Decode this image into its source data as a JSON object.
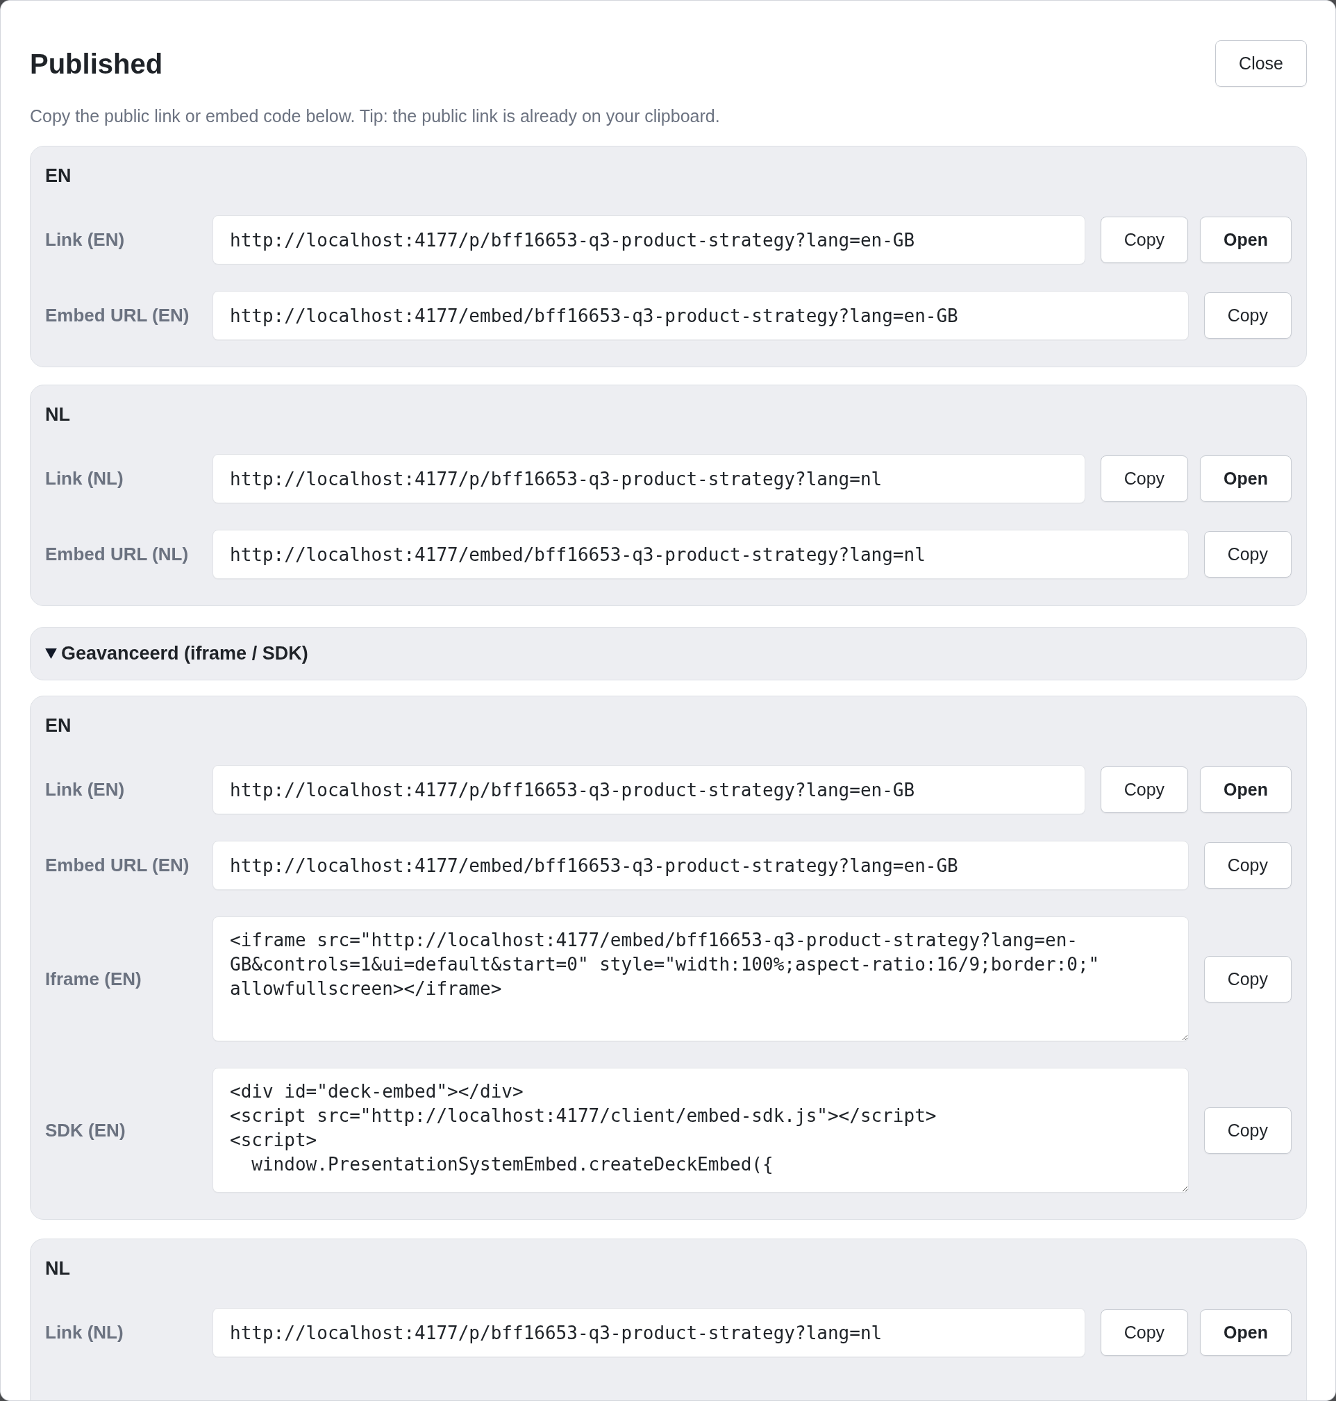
{
  "dialog": {
    "title": "Published",
    "close_button": "Close",
    "description": "Copy the public link or embed code below. Tip: the public link is already on your clipboard."
  },
  "sections": [
    {
      "heading": "EN",
      "rows": [
        {
          "kind": "input",
          "label": "Link (EN)",
          "value": "http://localhost:4177/p/bff16653-q3-product-strategy?lang=en-GB",
          "actions": [
            {
              "kind": "copy",
              "label": "Copy"
            },
            {
              "kind": "open",
              "label": "Open"
            }
          ]
        },
        {
          "kind": "input",
          "label": "Embed URL (EN)",
          "value": "http://localhost:4177/embed/bff16653-q3-product-strategy?lang=en-GB",
          "actions": [
            {
              "kind": "copy",
              "label": "Copy"
            }
          ]
        }
      ]
    },
    {
      "heading": "NL",
      "rows": [
        {
          "kind": "input",
          "label": "Link (NL)",
          "value": "http://localhost:4177/p/bff16653-q3-product-strategy?lang=nl",
          "actions": [
            {
              "kind": "copy",
              "label": "Copy"
            },
            {
              "kind": "open",
              "label": "Open"
            }
          ]
        },
        {
          "kind": "input",
          "label": "Embed URL (NL)",
          "value": "http://localhost:4177/embed/bff16653-q3-product-strategy?lang=nl",
          "actions": [
            {
              "kind": "copy",
              "label": "Copy"
            }
          ]
        }
      ]
    }
  ],
  "advanced": {
    "summary": "Geavanceerd (iframe / SDK)",
    "expanded": true,
    "sections": [
      {
        "heading": "EN",
        "rows": [
          {
            "kind": "input",
            "label": "Link (EN)",
            "value": "http://localhost:4177/p/bff16653-q3-product-strategy?lang=en-GB",
            "actions": [
              {
                "kind": "copy",
                "label": "Copy"
              },
              {
                "kind": "open",
                "label": "Open"
              }
            ]
          },
          {
            "kind": "input",
            "label": "Embed URL (EN)",
            "value": "http://localhost:4177/embed/bff16653-q3-product-strategy?lang=en-GB",
            "actions": [
              {
                "kind": "copy",
                "label": "Copy"
              }
            ]
          },
          {
            "kind": "textarea",
            "label": "Iframe (EN)",
            "value": "<iframe src=\"http://localhost:4177/embed/bff16653-q3-product-strategy?lang=en-GB&controls=1&ui=default&start=0\" style=\"width:100%;aspect-ratio:16/9;border:0;\" allowfullscreen></iframe>",
            "actions": [
              {
                "kind": "copy",
                "label": "Copy"
              }
            ]
          },
          {
            "kind": "textarea",
            "label": "SDK (EN)",
            "value": "<div id=\"deck-embed\"></div>\n<script src=\"http://localhost:4177/client/embed-sdk.js\"></script>\n<script>\n  window.PresentationSystemEmbed.createDeckEmbed({",
            "actions": [
              {
                "kind": "copy",
                "label": "Copy"
              }
            ]
          }
        ]
      },
      {
        "heading": "NL",
        "rows": [
          {
            "kind": "input",
            "label": "Link (NL)",
            "value": "http://localhost:4177/p/bff16653-q3-product-strategy?lang=nl",
            "actions": [
              {
                "kind": "copy",
                "label": "Copy"
              },
              {
                "kind": "open",
                "label": "Open"
              }
            ]
          }
        ]
      }
    ]
  }
}
